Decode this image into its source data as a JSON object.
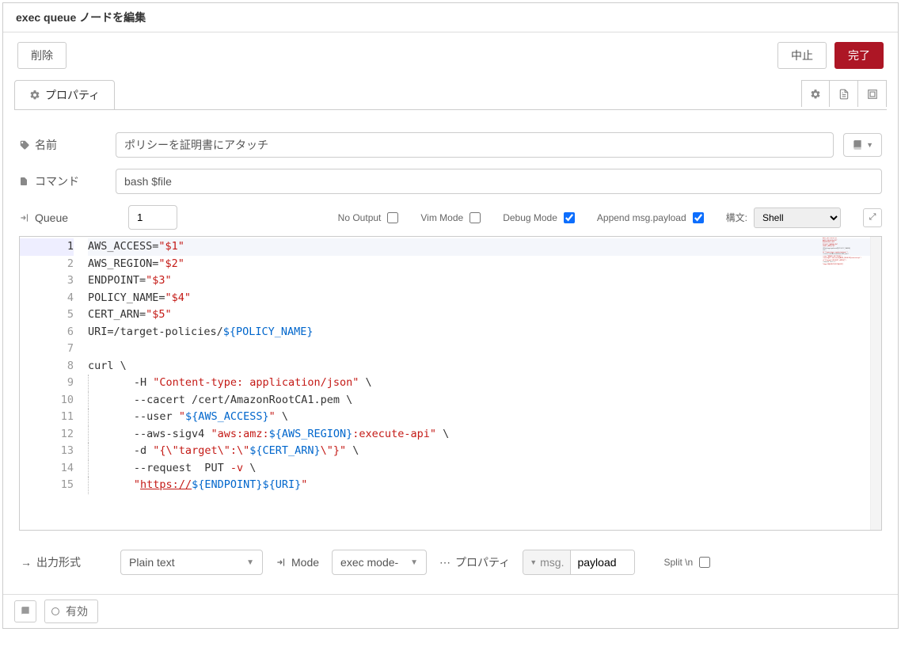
{
  "header": {
    "bold": "exec queue",
    "rest": " ノードを編集"
  },
  "buttons": {
    "delete": "削除",
    "cancel": "中止",
    "done": "完了"
  },
  "tabs": {
    "properties": "プロパティ"
  },
  "form": {
    "name_label": "名前",
    "name_value": "ポリシーを証明書にアタッチ",
    "command_label": "コマンド",
    "command_value": "bash $file",
    "queue_label": "Queue",
    "queue_value": "1"
  },
  "opts": {
    "no_output": "No Output",
    "vim_mode": "Vim Mode",
    "debug_mode": "Debug Mode",
    "append": "Append msg.payload",
    "syntax_label": "構文:",
    "syntax_value": "Shell",
    "no_output_checked": false,
    "vim_mode_checked": false,
    "debug_mode_checked": true,
    "append_checked": true
  },
  "editor": {
    "lines": [
      [
        {
          "t": "AWS_ACCESS",
          "c": "s-var"
        },
        {
          "t": "=",
          "c": ""
        },
        {
          "t": "\"$1\"",
          "c": "s-str"
        }
      ],
      [
        {
          "t": "AWS_REGION",
          "c": "s-var"
        },
        {
          "t": "=",
          "c": ""
        },
        {
          "t": "\"$2\"",
          "c": "s-str"
        }
      ],
      [
        {
          "t": "ENDPOINT",
          "c": "s-var"
        },
        {
          "t": "=",
          "c": ""
        },
        {
          "t": "\"$3\"",
          "c": "s-str"
        }
      ],
      [
        {
          "t": "POLICY_NAME",
          "c": "s-var"
        },
        {
          "t": "=",
          "c": ""
        },
        {
          "t": "\"$4\"",
          "c": "s-str"
        }
      ],
      [
        {
          "t": "CERT_ARN",
          "c": "s-var"
        },
        {
          "t": "=",
          "c": ""
        },
        {
          "t": "\"$5\"",
          "c": "s-str"
        }
      ],
      [
        {
          "t": "URI",
          "c": "s-var"
        },
        {
          "t": "=/",
          "c": ""
        },
        {
          "t": "target-policies",
          "c": "s-var"
        },
        {
          "t": "/",
          "c": ""
        },
        {
          "t": "${",
          "c": "s-par"
        },
        {
          "t": "POLICY_NAME",
          "c": "s-par"
        },
        {
          "t": "}",
          "c": "s-par"
        }
      ],
      [],
      [
        {
          "t": "curl ",
          "c": "s-cmd"
        },
        {
          "t": "\\",
          "c": ""
        }
      ],
      [
        {
          "ind": 8
        },
        {
          "t": "-H ",
          "c": ""
        },
        {
          "t": "\"Content-type: application/json\"",
          "c": "s-str"
        },
        {
          "t": " \\",
          "c": ""
        }
      ],
      [
        {
          "ind": 8
        },
        {
          "t": "--cacert /",
          "c": ""
        },
        {
          "t": "cert",
          "c": "s-var"
        },
        {
          "t": "/AmazonRootCA1.pem \\",
          "c": ""
        }
      ],
      [
        {
          "ind": 8
        },
        {
          "t": "--user ",
          "c": ""
        },
        {
          "t": "\"",
          "c": "s-str"
        },
        {
          "t": "${",
          "c": "s-par"
        },
        {
          "t": "AWS_ACCESS",
          "c": "s-par"
        },
        {
          "t": "}",
          "c": "s-par"
        },
        {
          "t": "\"",
          "c": "s-str"
        },
        {
          "t": " \\",
          "c": ""
        }
      ],
      [
        {
          "ind": 8
        },
        {
          "t": "--aws-sigv4 ",
          "c": ""
        },
        {
          "t": "\"aws:amz:",
          "c": "s-str"
        },
        {
          "t": "${",
          "c": "s-par"
        },
        {
          "t": "AWS_REGION",
          "c": "s-par"
        },
        {
          "t": "}",
          "c": "s-par"
        },
        {
          "t": ":execute-api\"",
          "c": "s-str"
        },
        {
          "t": " \\",
          "c": ""
        }
      ],
      [
        {
          "ind": 8
        },
        {
          "t": "-d ",
          "c": ""
        },
        {
          "t": "\"{\\\"target\\\":\\\"",
          "c": "s-str"
        },
        {
          "t": "${",
          "c": "s-par"
        },
        {
          "t": "CERT_ARN",
          "c": "s-par"
        },
        {
          "t": "}",
          "c": "s-par"
        },
        {
          "t": "\\\"}\"",
          "c": "s-str"
        },
        {
          "t": " \\",
          "c": ""
        }
      ],
      [
        {
          "ind": 8
        },
        {
          "t": "--request  PUT ",
          "c": ""
        },
        {
          "t": "-v",
          "c": "s-op"
        },
        {
          "t": " \\",
          "c": ""
        }
      ],
      [
        {
          "ind": 8
        },
        {
          "t": "\"",
          "c": "s-str"
        },
        {
          "t": "https://",
          "c": "s-url"
        },
        {
          "t": "${",
          "c": "s-par"
        },
        {
          "t": "ENDPOINT",
          "c": "s-par"
        },
        {
          "t": "}${",
          "c": "s-par"
        },
        {
          "t": "URI",
          "c": "s-par"
        },
        {
          "t": "}",
          "c": "s-par"
        },
        {
          "t": "\"",
          "c": "s-str"
        }
      ]
    ],
    "active_line": 1
  },
  "bottom": {
    "output_label": "出力形式",
    "output_value": "Plain text",
    "mode_label": "Mode",
    "mode_value": "exec mode-",
    "property_label": "プロパティ",
    "msg_prefix": "msg.",
    "msg_value": "payload",
    "split_label": "Split \\n",
    "split_checked": false
  },
  "footer": {
    "enabled": "有効"
  }
}
